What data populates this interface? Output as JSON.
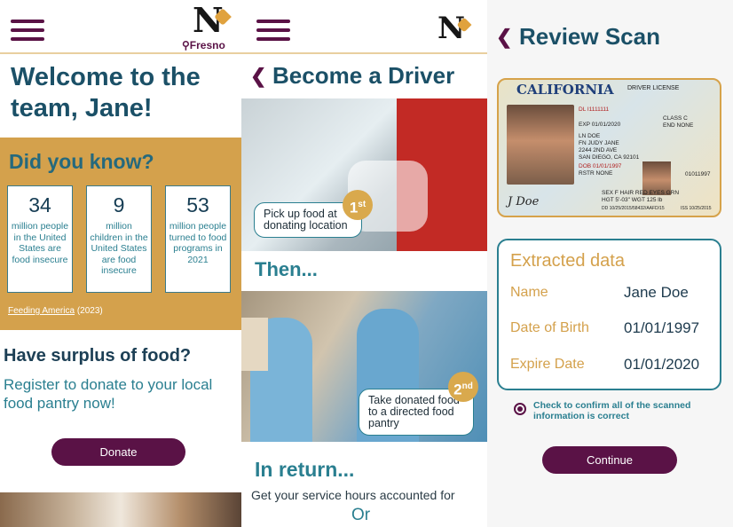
{
  "screen1": {
    "location": "Fresno",
    "logo_letter": "N",
    "welcome": "Welcome to the team, Jane!",
    "did_you_know": "Did you know?",
    "stats": [
      {
        "value": "34",
        "text": "million people in the United States are food insecure"
      },
      {
        "value": "9",
        "text": "million children in the United States are food insecure"
      },
      {
        "value": "53",
        "text": "million people turned to food programs in 2021"
      }
    ],
    "source_link": "Feeding America",
    "source_year": " (2023)",
    "surplus_heading": "Have surplus of food?",
    "register_text": "Register to donate to your local food pantry now!",
    "donate_label": "Donate"
  },
  "screen2": {
    "logo_letter": "N",
    "title": "Become a Driver",
    "step1_caption": "Pick up food at donating location",
    "step1_badge": "1",
    "step1_badge_suffix": "st",
    "then": "Then...",
    "step2_caption": "Take donated food to a directed food pantry",
    "step2_badge": "2",
    "step2_badge_suffix": "nd",
    "in_return": "In return...",
    "service_text": "Get your service hours accounted for",
    "or_text": "Or"
  },
  "screen3": {
    "title": "Review Scan",
    "license": {
      "state": "CALIFORNIA",
      "type": "DRIVER LICENSE",
      "dl": "DL  I1111111",
      "exp": "EXP  01/01/2020",
      "class": "CLASS C",
      "end": "END NONE",
      "ln": "LN  DOE",
      "fn": "FN  JUDY JANE",
      "addr1": "2244 2ND AVE",
      "addr2": "SAN DIEGO, CA 92101",
      "dob": "DOB  01/01/1997",
      "rstr": "RSTR  NONE",
      "num": "01011997",
      "sex": "SEX F    HAIR RED    EYES GRN",
      "hgt": "HGT 5'-03\"  WGT 125 lb",
      "dd": "DD 10/25/2015/58432/AAFD/15",
      "iss": "ISS 10/25/2015",
      "signature": "J Doe"
    },
    "extracted_title": "Extracted data",
    "fields": [
      {
        "label": "Name",
        "value": "Jane Doe"
      },
      {
        "label": "Date of Birth",
        "value": "01/01/1997"
      },
      {
        "label": "Expire Date",
        "value": "01/01/2020"
      }
    ],
    "confirm_text": "Check to confirm all of the scanned information is correct",
    "continue_label": "Continue"
  },
  "colors": {
    "brand_plum": "#5a1246",
    "teal": "#2a7f90",
    "gold": "#d4a14c",
    "navy": "#1b5067"
  },
  "icons": [
    "menu-icon",
    "location-pin-icon",
    "back-chevron-icon",
    "radio-checked-icon"
  ]
}
